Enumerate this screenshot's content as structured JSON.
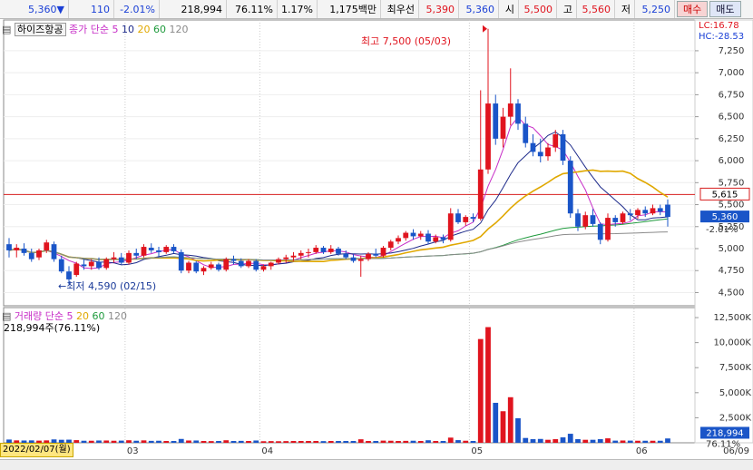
{
  "topbar": {
    "price": "5,360",
    "change": "110",
    "change_pct": "-2.01%",
    "volume": "218,994",
    "vol_pct": "76.11%",
    "turnover_pct": "1.17%",
    "amount": "1,175백만",
    "ask_label": "최우선",
    "ask": "5,390",
    "bid": "5,360",
    "open_label": "시",
    "open": "5,500",
    "high_label": "고",
    "high": "5,560",
    "low_label": "저",
    "low": "5,250",
    "buy_label": "매수",
    "sell_label": "매도"
  },
  "price_panel": {
    "stock_name": "하이즈항공",
    "ma_label": "종가 단순",
    "ma_periods": [
      "5",
      "10",
      "20",
      "60",
      "120"
    ],
    "lc": "LC:16.78",
    "hc": "HC:-28.53",
    "high_annotation": "최고 7,500 (05/03)",
    "low_annotation": "최저 4,590 (02/15)",
    "ref_line_label": "5,615",
    "last_price_label": "5,360",
    "last_change_label": "-2.01%"
  },
  "volume_panel": {
    "label": "거래량 단순",
    "ma_periods": [
      "5",
      "20",
      "60",
      "120"
    ],
    "current": "218,994주(76.11%)",
    "last_label": "218,994",
    "last_pct": "76.11%"
  },
  "x_axis": {
    "start_date": "2022/02/07(월)",
    "months": [
      "03",
      "04",
      "05",
      "06"
    ],
    "end_label": "06/09"
  },
  "colors": {
    "up": "#e0141e",
    "down": "#1a55c8",
    "ma5": "#c72ec7",
    "ma10": "#1d2a8a",
    "ma20": "#e0a800",
    "ma60": "#1e9a3c",
    "ma120": "#8a8a8a",
    "ref_line": "#d71e1e"
  },
  "chart_data": [
    {
      "type": "candlestick",
      "title": "하이즈항공",
      "y_axis_ticks": [
        4500,
        4750,
        5000,
        5250,
        5500,
        5750,
        6000,
        6250,
        6500,
        6750,
        7000,
        7250
      ],
      "ylim": [
        4350,
        7600
      ],
      "x_labels": [
        "03",
        "04",
        "05",
        "06"
      ],
      "reference_line": 5615,
      "candles": [
        {
          "o": 5050,
          "h": 5120,
          "l": 4900,
          "c": 4980
        },
        {
          "o": 4980,
          "h": 5050,
          "l": 4900,
          "c": 5010
        },
        {
          "o": 5000,
          "h": 5060,
          "l": 4920,
          "c": 4950
        },
        {
          "o": 4950,
          "h": 5000,
          "l": 4850,
          "c": 4880
        },
        {
          "o": 4900,
          "h": 5000,
          "l": 4870,
          "c": 4980
        },
        {
          "o": 4980,
          "h": 5100,
          "l": 4950,
          "c": 5070
        },
        {
          "o": 5050,
          "h": 5080,
          "l": 4850,
          "c": 4880
        },
        {
          "o": 4880,
          "h": 4920,
          "l": 4720,
          "c": 4740
        },
        {
          "o": 4740,
          "h": 4800,
          "l": 4590,
          "c": 4650
        },
        {
          "o": 4700,
          "h": 4850,
          "l": 4680,
          "c": 4830
        },
        {
          "o": 4820,
          "h": 4880,
          "l": 4760,
          "c": 4800
        },
        {
          "o": 4800,
          "h": 4880,
          "l": 4760,
          "c": 4850
        },
        {
          "o": 4850,
          "h": 4900,
          "l": 4760,
          "c": 4780
        },
        {
          "o": 4780,
          "h": 4900,
          "l": 4760,
          "c": 4880
        },
        {
          "o": 4880,
          "h": 4960,
          "l": 4840,
          "c": 4900
        },
        {
          "o": 4900,
          "h": 4950,
          "l": 4820,
          "c": 4840
        },
        {
          "o": 4840,
          "h": 4980,
          "l": 4820,
          "c": 4950
        },
        {
          "o": 4950,
          "h": 5000,
          "l": 4880,
          "c": 4920
        },
        {
          "o": 4920,
          "h": 5050,
          "l": 4900,
          "c": 5020
        },
        {
          "o": 5010,
          "h": 5060,
          "l": 4950,
          "c": 4980
        },
        {
          "o": 4980,
          "h": 5020,
          "l": 4900,
          "c": 4960
        },
        {
          "o": 4960,
          "h": 5040,
          "l": 4940,
          "c": 5020
        },
        {
          "o": 5020,
          "h": 5050,
          "l": 4950,
          "c": 4970
        },
        {
          "o": 4960,
          "h": 4990,
          "l": 4720,
          "c": 4750
        },
        {
          "o": 4750,
          "h": 4860,
          "l": 4720,
          "c": 4840
        },
        {
          "o": 4840,
          "h": 4860,
          "l": 4720,
          "c": 4740
        },
        {
          "o": 4740,
          "h": 4800,
          "l": 4700,
          "c": 4780
        },
        {
          "o": 4780,
          "h": 4850,
          "l": 4760,
          "c": 4820
        },
        {
          "o": 4820,
          "h": 4840,
          "l": 4740,
          "c": 4760
        },
        {
          "o": 4760,
          "h": 4900,
          "l": 4740,
          "c": 4880
        },
        {
          "o": 4880,
          "h": 4920,
          "l": 4820,
          "c": 4860
        },
        {
          "o": 4860,
          "h": 4890,
          "l": 4780,
          "c": 4800
        },
        {
          "o": 4800,
          "h": 4880,
          "l": 4780,
          "c": 4860
        },
        {
          "o": 4860,
          "h": 4880,
          "l": 4740,
          "c": 4760
        },
        {
          "o": 4760,
          "h": 4820,
          "l": 4740,
          "c": 4800
        },
        {
          "o": 4800,
          "h": 4850,
          "l": 4760,
          "c": 4840
        },
        {
          "o": 4840,
          "h": 4900,
          "l": 4820,
          "c": 4880
        },
        {
          "o": 4880,
          "h": 4930,
          "l": 4840,
          "c": 4900
        },
        {
          "o": 4900,
          "h": 4960,
          "l": 4860,
          "c": 4920
        },
        {
          "o": 4920,
          "h": 4980,
          "l": 4880,
          "c": 4950
        },
        {
          "o": 4950,
          "h": 5000,
          "l": 4900,
          "c": 4960
        },
        {
          "o": 4960,
          "h": 5040,
          "l": 4940,
          "c": 5010
        },
        {
          "o": 5010,
          "h": 5030,
          "l": 4940,
          "c": 4960
        },
        {
          "o": 4960,
          "h": 5040,
          "l": 4940,
          "c": 5000
        },
        {
          "o": 5000,
          "h": 5020,
          "l": 4920,
          "c": 4940
        },
        {
          "o": 4940,
          "h": 4980,
          "l": 4880,
          "c": 4900
        },
        {
          "o": 4900,
          "h": 4940,
          "l": 4840,
          "c": 4860
        },
        {
          "o": 4860,
          "h": 4920,
          "l": 4680,
          "c": 4880
        },
        {
          "o": 4880,
          "h": 4960,
          "l": 4860,
          "c": 4940
        },
        {
          "o": 4940,
          "h": 5000,
          "l": 4900,
          "c": 4920
        },
        {
          "o": 4920,
          "h": 5030,
          "l": 4900,
          "c": 5010
        },
        {
          "o": 5010,
          "h": 5100,
          "l": 4980,
          "c": 5080
        },
        {
          "o": 5080,
          "h": 5150,
          "l": 5050,
          "c": 5120
        },
        {
          "o": 5120,
          "h": 5200,
          "l": 5090,
          "c": 5180
        },
        {
          "o": 5180,
          "h": 5220,
          "l": 5100,
          "c": 5140
        },
        {
          "o": 5140,
          "h": 5200,
          "l": 5100,
          "c": 5170
        },
        {
          "o": 5170,
          "h": 5210,
          "l": 5050,
          "c": 5080
        },
        {
          "o": 5080,
          "h": 5160,
          "l": 5060,
          "c": 5130
        },
        {
          "o": 5130,
          "h": 5160,
          "l": 5060,
          "c": 5100
        },
        {
          "o": 5100,
          "h": 5460,
          "l": 5080,
          "c": 5400
        },
        {
          "o": 5400,
          "h": 5450,
          "l": 5280,
          "c": 5300
        },
        {
          "o": 5300,
          "h": 5380,
          "l": 5260,
          "c": 5360
        },
        {
          "o": 5360,
          "h": 5400,
          "l": 5300,
          "c": 5340
        },
        {
          "o": 5340,
          "h": 6800,
          "l": 5320,
          "c": 5900
        },
        {
          "o": 5900,
          "h": 7500,
          "l": 5850,
          "c": 6650
        },
        {
          "o": 6650,
          "h": 6750,
          "l": 6180,
          "c": 6250
        },
        {
          "o": 6250,
          "h": 6600,
          "l": 6150,
          "c": 6500
        },
        {
          "o": 6500,
          "h": 7050,
          "l": 6400,
          "c": 6650
        },
        {
          "o": 6650,
          "h": 6700,
          "l": 6350,
          "c": 6420
        },
        {
          "o": 6420,
          "h": 6500,
          "l": 6150,
          "c": 6200
        },
        {
          "o": 6200,
          "h": 6300,
          "l": 6050,
          "c": 6100
        },
        {
          "o": 6100,
          "h": 6250,
          "l": 5980,
          "c": 6050
        },
        {
          "o": 6050,
          "h": 6200,
          "l": 6000,
          "c": 6150
        },
        {
          "o": 6150,
          "h": 6350,
          "l": 6100,
          "c": 6300
        },
        {
          "o": 6300,
          "h": 6350,
          "l": 5950,
          "c": 6000
        },
        {
          "o": 6000,
          "h": 6050,
          "l": 5350,
          "c": 5400
        },
        {
          "o": 5400,
          "h": 5450,
          "l": 5200,
          "c": 5250
        },
        {
          "o": 5250,
          "h": 5420,
          "l": 5220,
          "c": 5380
        },
        {
          "o": 5380,
          "h": 5450,
          "l": 5250,
          "c": 5280
        },
        {
          "o": 5280,
          "h": 5300,
          "l": 5050,
          "c": 5100
        },
        {
          "o": 5100,
          "h": 5400,
          "l": 5080,
          "c": 5350
        },
        {
          "o": 5350,
          "h": 5380,
          "l": 5250,
          "c": 5300
        },
        {
          "o": 5300,
          "h": 5420,
          "l": 5280,
          "c": 5400
        },
        {
          "o": 5400,
          "h": 5450,
          "l": 5320,
          "c": 5380
        },
        {
          "o": 5380,
          "h": 5460,
          "l": 5340,
          "c": 5440
        },
        {
          "o": 5440,
          "h": 5480,
          "l": 5360,
          "c": 5400
        },
        {
          "o": 5400,
          "h": 5500,
          "l": 5380,
          "c": 5460
        },
        {
          "o": 5460,
          "h": 5500,
          "l": 5380,
          "c": 5420
        },
        {
          "o": 5500,
          "h": 5560,
          "l": 5250,
          "c": 5360
        }
      ]
    },
    {
      "type": "bar",
      "title": "거래량",
      "y_axis_ticks": [
        2500,
        5000,
        7500,
        10000,
        12500
      ],
      "y_axis_labels": [
        "2,500K",
        "5,000K",
        "7,500K",
        "10,000K",
        "12,500K"
      ],
      "ylim": [
        0,
        13500
      ],
      "note": "values in thousands of shares"
    }
  ]
}
